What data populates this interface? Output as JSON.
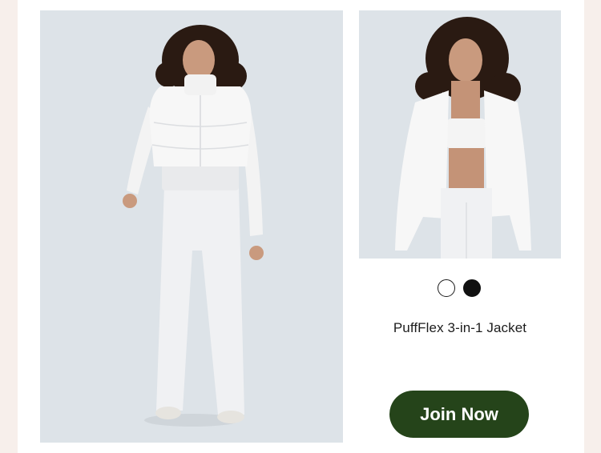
{
  "product": {
    "title": "PuffFlex 3-in-1 Jacket",
    "swatches": [
      {
        "name": "white",
        "color": "#ffffff"
      },
      {
        "name": "black",
        "color": "#111111"
      }
    ]
  },
  "cta": {
    "label": "Join Now",
    "color": "#25441a"
  },
  "colors": {
    "page_background": "#f7efeb",
    "card_background": "#ffffff",
    "photo_background": "#dde3e8"
  }
}
